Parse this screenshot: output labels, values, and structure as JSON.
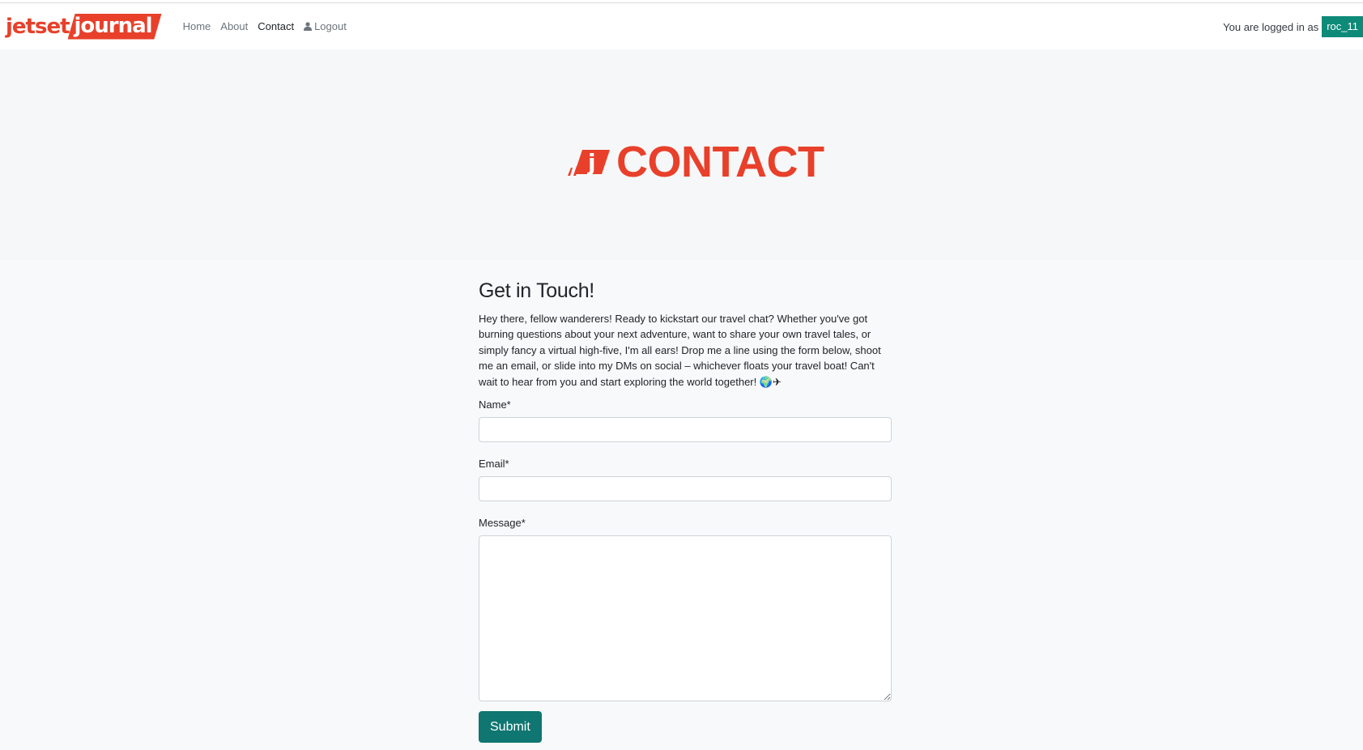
{
  "brand": {
    "part1": "jetset",
    "part2": "journal"
  },
  "nav": {
    "items": [
      {
        "label": "Home"
      },
      {
        "label": "About"
      },
      {
        "label": "Contact"
      },
      {
        "label": "Logout",
        "icon": "person-icon"
      }
    ],
    "active": "Contact"
  },
  "user": {
    "logged_in_text": "You are logged in as",
    "username": "roc_11"
  },
  "hero": {
    "title": "CONTACT",
    "logo_letter": "j"
  },
  "form": {
    "heading": "Get in Touch!",
    "intro": "Hey there, fellow wanderers! Ready to kickstart our travel chat? Whether you've got burning questions about your next adventure, want to share your own travel tales, or simply fancy a virtual high-five, I'm all ears! Drop me a line using the form below, shoot me an email, or slide into my DMs on social – whichever floats your travel boat! Can't wait to hear from you and start exploring the world together! 🌍✈",
    "name_label": "Name*",
    "name_value": "",
    "email_label": "Email*",
    "email_value": "",
    "message_label": "Message*",
    "message_value": "",
    "submit_label": "Submit"
  },
  "colors": {
    "brand": "#e8402a",
    "accent": "#0e8a79",
    "button": "#0f7671"
  }
}
